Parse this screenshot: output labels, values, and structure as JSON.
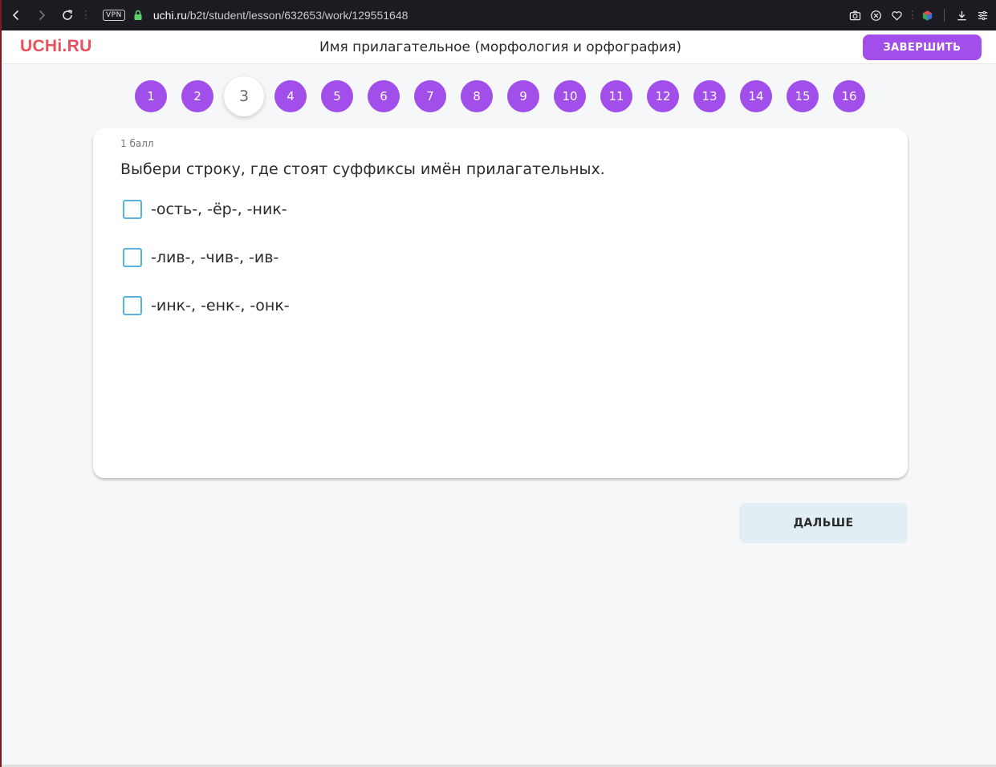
{
  "browser": {
    "vpn_label": "VPN",
    "url_host": "uchi.ru",
    "url_path": "/b2t/student/lesson/632653/work/129551648"
  },
  "header": {
    "logo": "UCHi.RU",
    "title": "Имя прилагательное (морфология и орфография)",
    "finish_label": "ЗАВЕРШИТЬ"
  },
  "questions_nav": {
    "items": [
      "1",
      "2",
      "3",
      "4",
      "5",
      "6",
      "7",
      "8",
      "9",
      "10",
      "11",
      "12",
      "13",
      "14",
      "15",
      "16"
    ],
    "active": "3"
  },
  "task": {
    "points": "1 балл",
    "question": "Выбери строку, где стоят суффиксы имён прилагательных.",
    "options": [
      {
        "label": "-ость-, -ёр-, -ник-",
        "checked": false
      },
      {
        "label": "-лив-, -чив-, -ив-",
        "checked": false
      },
      {
        "label": "-инк-, -енк-, -онк-",
        "checked": false
      }
    ]
  },
  "next_label": "ДАЛЬШЕ",
  "colors": {
    "accent": "#a24eea",
    "logo": "#e8505b",
    "checkbox_border": "#57b4d8",
    "next_bg": "#e1eff4"
  }
}
